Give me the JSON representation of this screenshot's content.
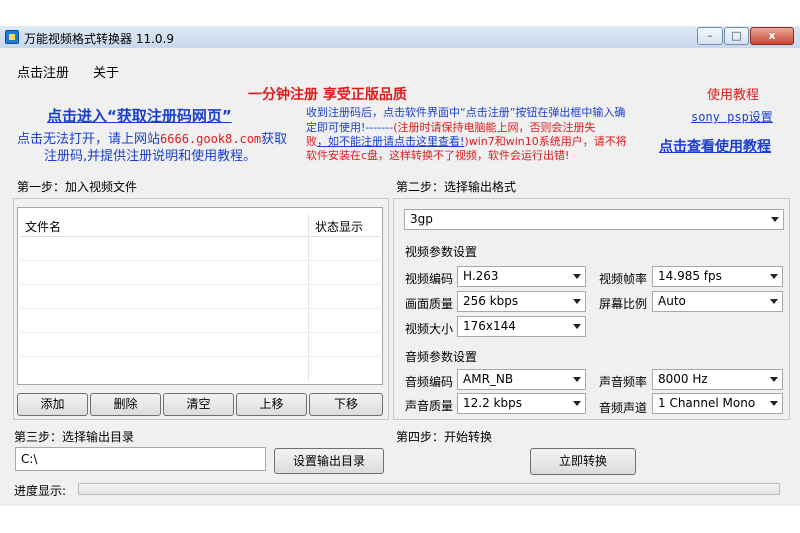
{
  "window": {
    "title": "万能视频格式转换器 11.0.9",
    "minimize": "–",
    "maximize": "□",
    "close": "x"
  },
  "menu": {
    "register": "点击注册",
    "about": "关于"
  },
  "promo": {
    "register_slogan": "一分钟注册  享受正版品质",
    "tutorial": "使用教程",
    "get_code_link": "点击进入“获取注册码网页”",
    "alt_line1_prefix": "点击无法打开，请上网站",
    "alt_site": "6666.gook8.com",
    "alt_line1_suffix": "获取",
    "alt_line2": "注册码,并提供注册说明和使用教程。",
    "info_line1": "收到注册码后，点击软件界面中“点击注册”按钮在弹出框中输入确",
    "info_line2_blue": "定即可使用!-------",
    "info_line2_red": "(注册时请保持电脑能上网，否则会注册失",
    "info_line3_red1": "败",
    "info_line3_link": "，如不能注册请点击这里查看!",
    "info_line3_red2": ")",
    "info_line3_blue": "win7和win10系统用户，请不将",
    "info_line4": "软件安装在c盘，这样转换不了视频，软件会运行出错!",
    "sony_link": "sony psp设置",
    "usage_link": "点击查看使用教程"
  },
  "step1": {
    "title": "第一步：加入视频文件",
    "col_filename": "文件名",
    "col_status": "状态显示",
    "buttons": [
      "添加",
      "删除",
      "清空",
      "上移",
      "下移"
    ]
  },
  "step2": {
    "title": "第二步：选择输出格式",
    "format": "3gp",
    "video_group": "视频参数设置",
    "video_codec_label": "视频编码",
    "video_codec": "H.263",
    "frame_rate_label": "视频帧率",
    "frame_rate": "14.985 fps",
    "quality_label": "画面质量",
    "quality": "256 kbps",
    "aspect_label": "屏幕比例",
    "aspect": "Auto",
    "size_label": "视频大小",
    "size": "176x144",
    "audio_group": "音频参数设置",
    "audio_codec_label": "音频编码",
    "audio_codec": "AMR_NB",
    "sample_rate_label": "声音频率",
    "sample_rate": "8000 Hz",
    "audio_quality_label": "声音质量",
    "audio_quality": "12.2 kbps",
    "channels_label": "音频声道",
    "channels": "1 Channel Mono"
  },
  "step3": {
    "title": "第三步：选择输出目录",
    "path": "C:\\",
    "set_button": "设置输出目录"
  },
  "step4": {
    "title": "第四步：开始转换",
    "convert_button": "立即转换"
  },
  "progress": {
    "label": "进度显示:",
    "value_percent": 0
  }
}
